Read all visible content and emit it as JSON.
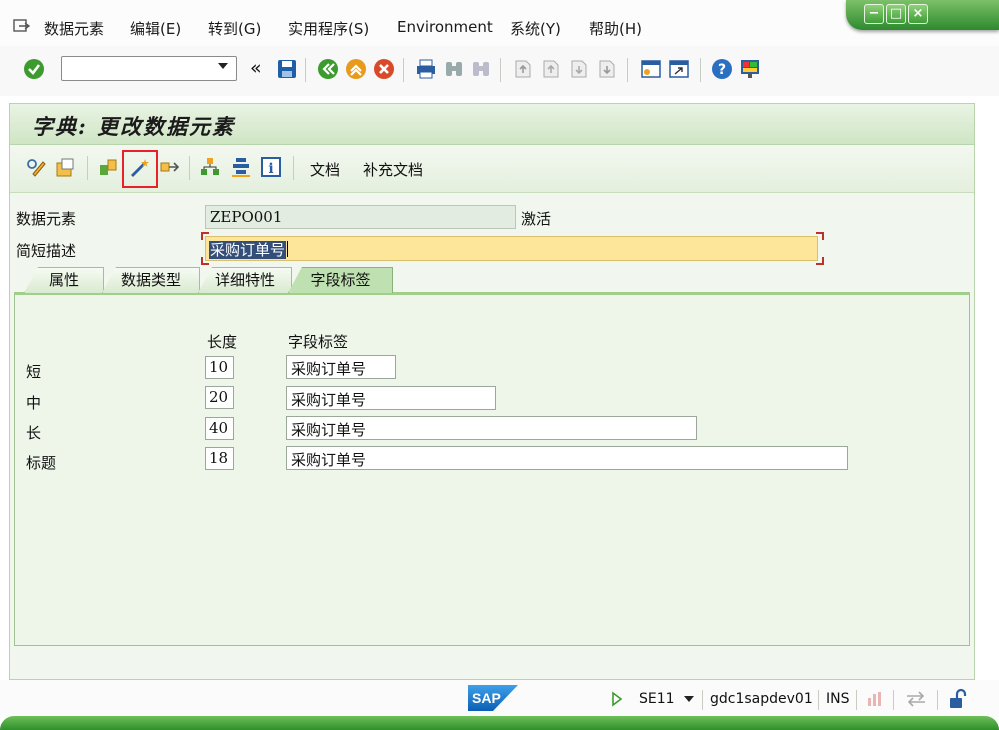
{
  "menu": {
    "items": [
      "数据元素",
      "编辑(E)",
      "转到(G)",
      "实用程序(S)",
      "Environment",
      "系统(Y)",
      "帮助(H)"
    ]
  },
  "window_controls": {
    "minimize": "−",
    "maximize": "□",
    "close": "×"
  },
  "toolbar": {
    "command_field_value": "",
    "back_symbol": "«",
    "icons": [
      "enter-icon",
      "save-icon",
      "back-icon",
      "exit-icon",
      "cancel-icon",
      "print-icon",
      "find-icon",
      "find-next-icon",
      "first-page-icon",
      "prev-page-icon",
      "next-page-icon",
      "last-page-icon",
      "create-session-icon",
      "shortcut-icon",
      "help-icon",
      "customize-layout-icon"
    ]
  },
  "page": {
    "title": "字典: 更改数据元素"
  },
  "app_toolbar": {
    "icons": [
      "display-change-icon",
      "other-object-icon",
      "check-icon",
      "activate-icon",
      "where-used-icon",
      "object-list-icon",
      "hierarchy-icon",
      "info-icon"
    ],
    "doc_label": "文档",
    "supp_doc_label": "补充文档"
  },
  "fields": {
    "data_element_label": "数据元素",
    "data_element_value": "ZEPO001",
    "status": "激活",
    "short_desc_label": "简短描述",
    "short_desc_value": "采购订单号"
  },
  "tabs": [
    {
      "label": "属性",
      "active": false
    },
    {
      "label": "数据类型",
      "active": false
    },
    {
      "label": "详细特性",
      "active": false
    },
    {
      "label": "字段标签",
      "active": true
    }
  ],
  "field_labels": {
    "header_length": "长度",
    "header_label": "字段标签",
    "rows": [
      {
        "name": "短",
        "length": "10",
        "text": "采购订单号"
      },
      {
        "name": "中",
        "length": "20",
        "text": "采购订单号"
      },
      {
        "name": "长",
        "length": "40",
        "text": "采购订单号"
      },
      {
        "name": "标题",
        "length": "18",
        "text": "采购订单号"
      }
    ]
  },
  "status_bar": {
    "logo": "SAP",
    "transaction": "SE11",
    "server": "gdc1sapdev01",
    "mode": "INS"
  },
  "colors": {
    "accent_green": "#3f9e37",
    "highlight_red": "#e8222a",
    "required_yellow": "#fde69a"
  }
}
